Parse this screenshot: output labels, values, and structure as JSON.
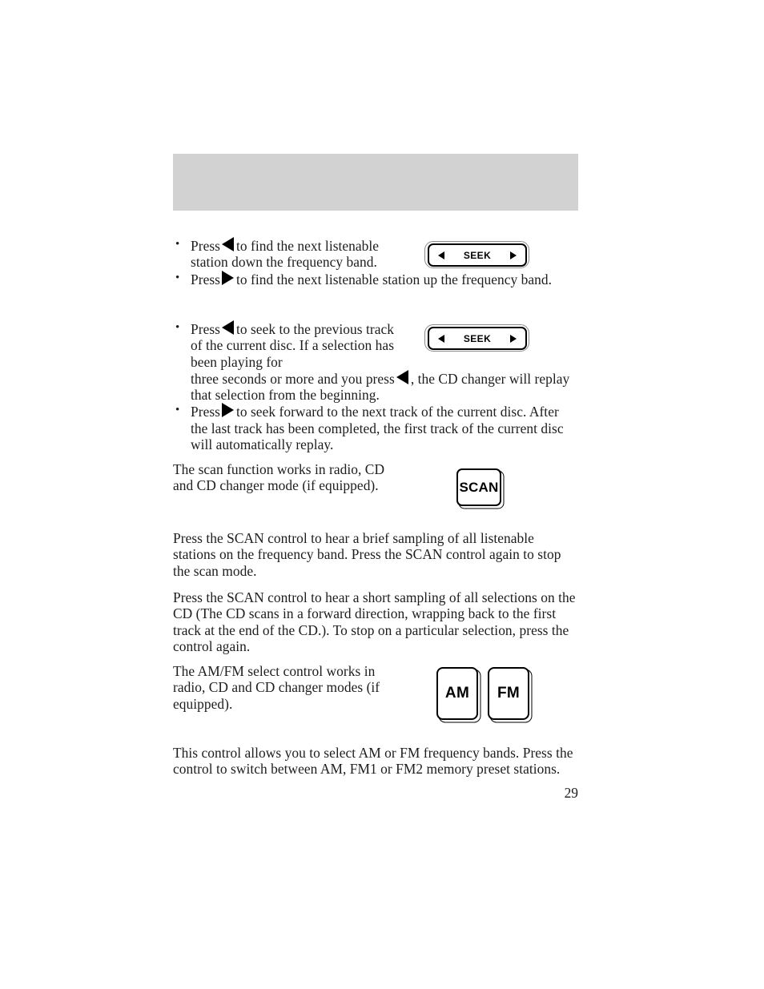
{
  "page": {
    "number": "29",
    "header_band": {
      "label": "",
      "color": "#d2d2d2"
    }
  },
  "seek_radio": {
    "bullets": [
      {
        "pre": "Press",
        "icon": "left-triangle-icon",
        "post": "to find the next listenable station down the frequency band."
      },
      {
        "pre": "Press",
        "icon": "right-triangle-icon",
        "post": "to find the next listenable station up the frequency band."
      }
    ],
    "control": {
      "name": "seek-control",
      "label": "SEEK",
      "left_arrow": "left-arrow-icon",
      "right_arrow": "right-arrow-icon"
    }
  },
  "seek_cd": {
    "bullets": [
      {
        "pre": "Press",
        "icon": "left-triangle-icon",
        "post": "to seek to the previous track of the current disc. If a selection has been playing for",
        "cont_pre": "three seconds or more and you press",
        "cont_icon": "left-triangle-icon",
        "cont_post": ", the CD changer will replay that selection from the beginning."
      },
      {
        "pre": "Press",
        "icon": "right-triangle-icon",
        "post": "to seek forward to the next track of the current disc. After the last track has been completed, the first track of the current disc will automatically replay."
      }
    ],
    "control": {
      "name": "seek-control",
      "label": "SEEK",
      "left_arrow": "left-arrow-icon",
      "right_arrow": "right-arrow-icon"
    }
  },
  "scan": {
    "intro": "The scan function works in radio, CD and CD changer mode (if equipped).",
    "control": {
      "name": "scan-control",
      "label": "SCAN"
    },
    "paragraph_radio": "Press the SCAN control to hear a brief sampling of all listenable stations on the frequency band. Press the SCAN control again to stop the scan mode.",
    "paragraph_cd": "Press the SCAN control to hear a short sampling of all selections on the CD (The CD scans in a forward direction, wrapping back to the first track at the end of the CD.). To stop on a particular selection, press the control again."
  },
  "amfm": {
    "intro": "The AM/FM select control works in radio, CD and CD changer modes (if equipped).",
    "controls": [
      {
        "name": "am-control",
        "label": "AM"
      },
      {
        "name": "fm-control",
        "label": "FM"
      }
    ],
    "paragraph": "This control allows you to select AM or FM frequency bands. Press the control to switch between AM, FM1 or FM2 memory preset stations."
  }
}
